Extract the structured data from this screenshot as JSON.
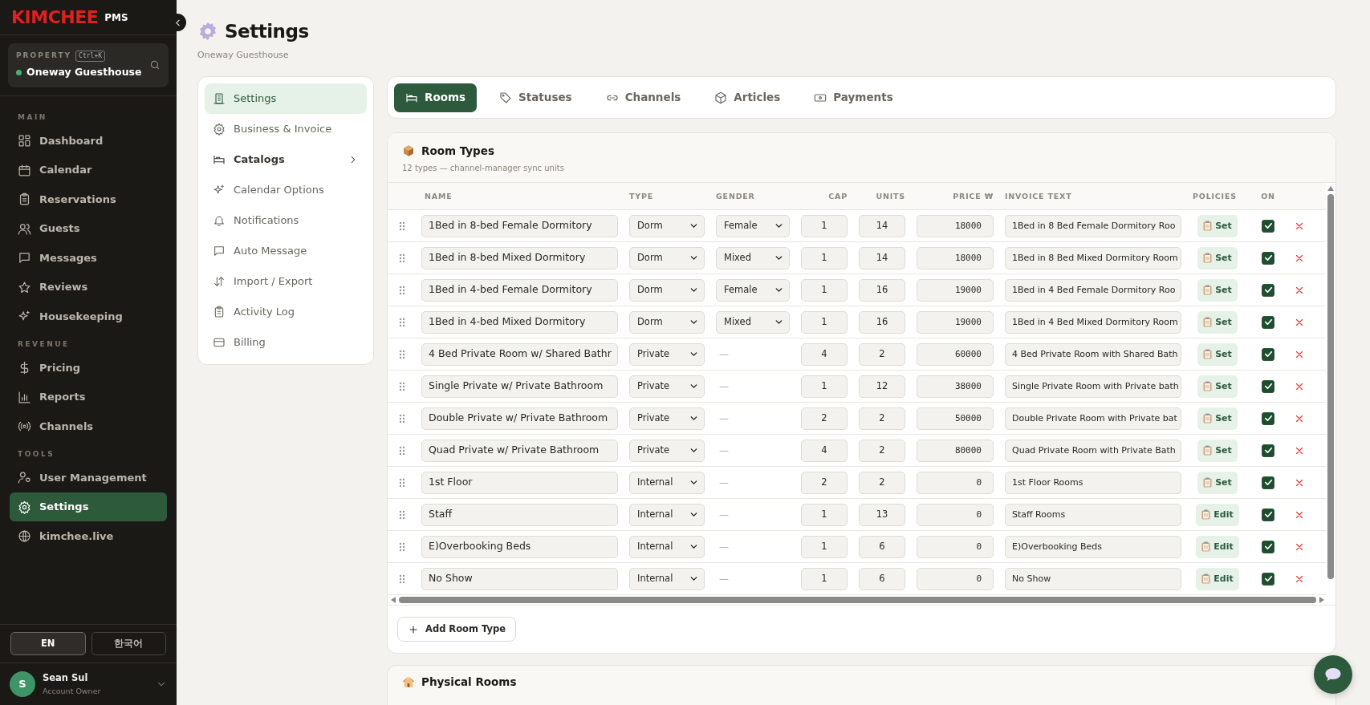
{
  "brand": {
    "logo": "KIMCHEE",
    "suffix": "PMS"
  },
  "property": {
    "label": "PROPERTY",
    "shortcut": "Ctrl+K",
    "name": "Oneway Guesthouse"
  },
  "nav_sections": [
    {
      "title": "MAIN",
      "items": [
        {
          "label": "Dashboard",
          "selected": false
        },
        {
          "label": "Calendar",
          "selected": false
        },
        {
          "label": "Reservations",
          "selected": false
        },
        {
          "label": "Guests",
          "selected": false
        },
        {
          "label": "Messages",
          "selected": false
        },
        {
          "label": "Reviews",
          "selected": false
        },
        {
          "label": "Housekeeping",
          "selected": false
        }
      ]
    },
    {
      "title": "REVENUE",
      "items": [
        {
          "label": "Pricing",
          "selected": false
        },
        {
          "label": "Reports",
          "selected": false
        },
        {
          "label": "Channels",
          "selected": false
        }
      ]
    },
    {
      "title": "TOOLS",
      "items": [
        {
          "label": "User Management",
          "selected": false
        },
        {
          "label": "Settings",
          "selected": true
        },
        {
          "label": "kimchee.live",
          "selected": false
        }
      ]
    }
  ],
  "languages": [
    {
      "label": "EN",
      "selected": true
    },
    {
      "label": "한국어",
      "selected": false
    }
  ],
  "user": {
    "initial": "S",
    "name": "Sean Sul",
    "role": "Account Owner"
  },
  "page": {
    "title": "Settings",
    "subtitle": "Oneway Guesthouse"
  },
  "settings_menu": [
    {
      "label": "Settings",
      "selected": true,
      "has_children": false
    },
    {
      "label": "Business & Invoice",
      "selected": false,
      "has_children": false
    },
    {
      "label": "Catalogs",
      "selected": false,
      "has_children": true
    },
    {
      "label": "Calendar Options",
      "selected": false,
      "has_children": false
    },
    {
      "label": "Notifications",
      "selected": false,
      "has_children": false
    },
    {
      "label": "Auto Message",
      "selected": false,
      "has_children": false
    },
    {
      "label": "Import / Export",
      "selected": false,
      "has_children": false
    },
    {
      "label": "Activity Log",
      "selected": false,
      "has_children": false
    },
    {
      "label": "Billing",
      "selected": false,
      "has_children": false
    }
  ],
  "tabs": [
    {
      "label": "Rooms",
      "selected": true
    },
    {
      "label": "Statuses",
      "selected": false
    },
    {
      "label": "Channels",
      "selected": false
    },
    {
      "label": "Articles",
      "selected": false
    },
    {
      "label": "Payments",
      "selected": false
    }
  ],
  "room_types": {
    "title": "Room Types",
    "subtitle": "12 types — channel-manager sync units",
    "columns": [
      "NAME",
      "TYPE",
      "GENDER",
      "CAP",
      "UNITS",
      "PRICE ₩",
      "INVOICE TEXT",
      "POLICIES",
      "ON"
    ],
    "rows": [
      {
        "name": "1Bed in 8-bed Female Dormitory",
        "type": "Dorm",
        "gender": {
          "kind": "select",
          "value": "Female"
        },
        "cap": "1",
        "units": "14",
        "price": "18000",
        "invoice_text": "1Bed in 8 Bed Female Dormitory Roo",
        "policy": "Set",
        "on": true
      },
      {
        "name": "1Bed in 8-bed Mixed Dormitory",
        "type": "Dorm",
        "gender": {
          "kind": "select",
          "value": "Mixed"
        },
        "cap": "1",
        "units": "14",
        "price": "18000",
        "invoice_text": "1Bed in 8 Bed Mixed Dormitory Room",
        "policy": "Set",
        "on": true
      },
      {
        "name": "1Bed in 4-bed Female Dormitory",
        "type": "Dorm",
        "gender": {
          "kind": "select",
          "value": "Female"
        },
        "cap": "1",
        "units": "16",
        "price": "19000",
        "invoice_text": "1Bed in 4 Bed Female Dormitory Roo",
        "policy": "Set",
        "on": true
      },
      {
        "name": "1Bed in 4-bed Mixed Dormitory",
        "type": "Dorm",
        "gender": {
          "kind": "select",
          "value": "Mixed"
        },
        "cap": "1",
        "units": "16",
        "price": "19000",
        "invoice_text": "1Bed in 4 Bed Mixed Dormitory Room",
        "policy": "Set",
        "on": true
      },
      {
        "name": "4 Bed Private Room w/ Shared Bathr",
        "type": "Private",
        "gender": {
          "kind": "none",
          "value": "—"
        },
        "cap": "4",
        "units": "2",
        "price": "60000",
        "invoice_text": "4 Bed Private Room with Shared Bath",
        "policy": "Set",
        "on": true
      },
      {
        "name": "Single Private w/ Private Bathroom",
        "type": "Private",
        "gender": {
          "kind": "none",
          "value": "—"
        },
        "cap": "1",
        "units": "12",
        "price": "38000",
        "invoice_text": "Single Private Room with Private bath",
        "policy": "Set",
        "on": true
      },
      {
        "name": "Double Private w/ Private Bathroom",
        "type": "Private",
        "gender": {
          "kind": "none",
          "value": "—"
        },
        "cap": "2",
        "units": "2",
        "price": "50000",
        "invoice_text": "Double Private Room with Private bat",
        "policy": "Set",
        "on": true
      },
      {
        "name": "Quad Private  w/ Private Bathroom",
        "type": "Private",
        "gender": {
          "kind": "none",
          "value": "—"
        },
        "cap": "4",
        "units": "2",
        "price": "80000",
        "invoice_text": "Quad Private Room with Private Bath",
        "policy": "Set",
        "on": true
      },
      {
        "name": "1st Floor",
        "type": "Internal",
        "gender": {
          "kind": "none",
          "value": "—"
        },
        "cap": "2",
        "units": "2",
        "price": "0",
        "invoice_text": "1st Floor Rooms",
        "policy": "Set",
        "on": true
      },
      {
        "name": "Staff",
        "type": "Internal",
        "gender": {
          "kind": "none",
          "value": "—"
        },
        "cap": "1",
        "units": "13",
        "price": "0",
        "invoice_text": "Staff Rooms",
        "policy": "Edit",
        "on": true
      },
      {
        "name": "E)Overbooking Beds",
        "type": "Internal",
        "gender": {
          "kind": "none",
          "value": "—"
        },
        "cap": "1",
        "units": "6",
        "price": "0",
        "invoice_text": "E)Overbooking Beds",
        "policy": "Edit",
        "on": true
      },
      {
        "name": "No Show",
        "type": "Internal",
        "gender": {
          "kind": "none",
          "value": "—"
        },
        "cap": "1",
        "units": "6",
        "price": "0",
        "invoice_text": "No Show",
        "policy": "Edit",
        "on": true
      }
    ],
    "add_button": "Add Room Type"
  },
  "physical_rooms": {
    "title": "Physical Rooms"
  }
}
